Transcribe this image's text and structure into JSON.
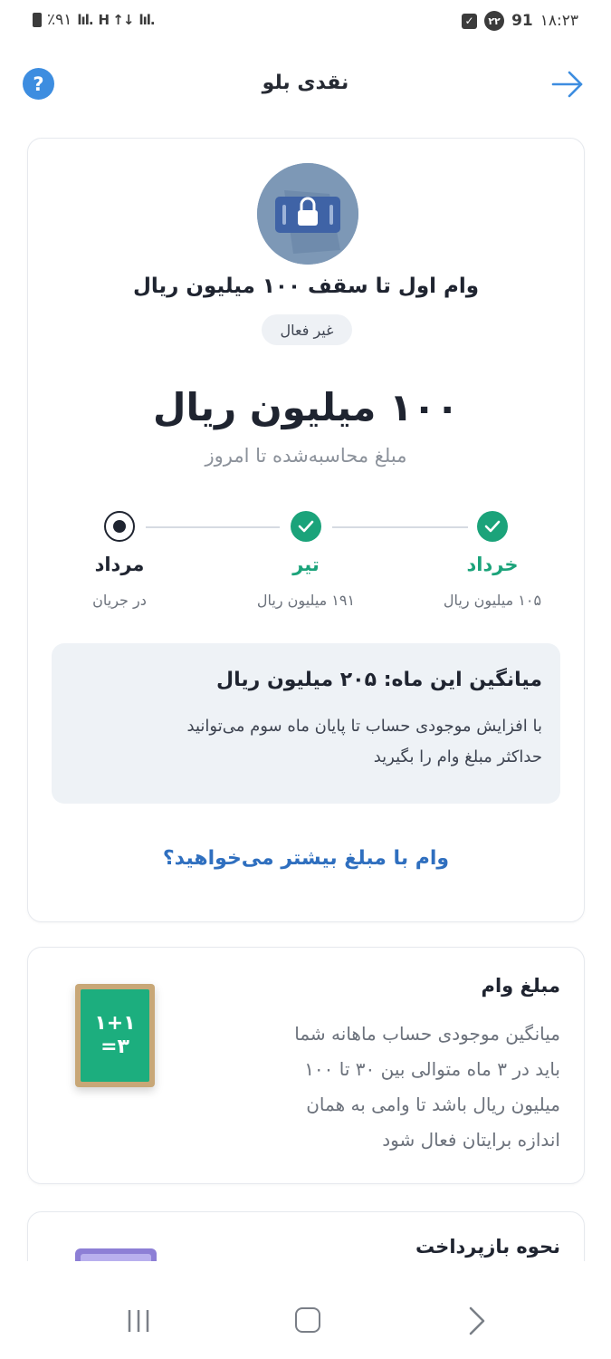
{
  "status_bar": {
    "battery": "٪۹۱",
    "signal_left": "lıl.",
    "data_indicator": "H ↑↓",
    "signal_right": "lıl.",
    "badge_count": "۲۲",
    "network_badge": "91",
    "time": "۱۸:۲۳"
  },
  "header": {
    "title": "نقدی بلو",
    "help_symbol": "?"
  },
  "loan": {
    "title": "وام اول تا سقف ۱۰۰ میلیون ریال",
    "status": "غیر فعال",
    "amount": "۱۰۰ میلیون ریال",
    "amount_caption": "مبلغ محاسبه‌شده تا امروز"
  },
  "steps": [
    {
      "label": "خرداد",
      "value": "۱۰۵ میلیون ریال",
      "state": "done"
    },
    {
      "label": "تیر",
      "value": "۱۹۱ میلیون ریال",
      "state": "done"
    },
    {
      "label": "مرداد",
      "value": "در جریان",
      "state": "current"
    }
  ],
  "info": {
    "title": "میانگین این ماه: ۲۰۵ میلیون ریال",
    "text_line1": "با افزایش موجودی حساب تا پایان ماه سوم می‌توانید",
    "text_line2": "حداکثر مبلغ وام را بگیرید"
  },
  "more_link": "وام با مبلغ بیشتر می‌خواهید؟",
  "amount_card": {
    "title": "مبلغ وام",
    "line1": "میانگین موجودی حساب ماهانه شما",
    "line2": "باید در ۳ ماه متوالی بین ۳۰ تا ۱۰۰",
    "line3": "میلیون ریال باشد تا وامی به همان",
    "line4": "اندازه برایتان فعال شود",
    "board_line1": "۱+۱",
    "board_line2": "=۳"
  },
  "repay_card": {
    "title": "نحوه بازپرداخت"
  },
  "colors": {
    "accent_blue": "#2f6fbf",
    "success_green": "#1ba37a",
    "help_blue": "#3d8de0"
  }
}
